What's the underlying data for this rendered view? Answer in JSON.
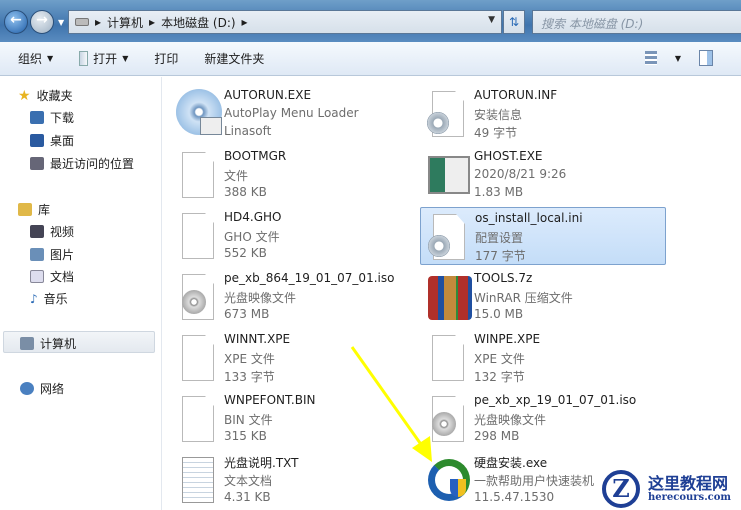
{
  "address": {
    "segments": [
      "计算机",
      "本地磁盘 (D:)"
    ],
    "search_placeholder": "搜索 本地磁盘 (D:)"
  },
  "toolbar": {
    "organize": "组织",
    "open": "打开",
    "print": "打印",
    "new_folder": "新建文件夹"
  },
  "sidebar": {
    "favorites": "收藏夹",
    "downloads": "下载",
    "desktop": "桌面",
    "recent": "最近访问的位置",
    "libraries": "库",
    "videos": "视频",
    "pictures": "图片",
    "documents": "文档",
    "music": "音乐",
    "computer": "计算机",
    "network": "网络"
  },
  "files": [
    {
      "name": "AUTORUN.EXE",
      "l2": "AutoPlay Menu Loader",
      "l3": "Linasoft",
      "icon": "autoplay-icon"
    },
    {
      "name": "AUTORUN.INF",
      "l2": "安装信息",
      "l3": "49 字节",
      "icon": "settings-file-icon"
    },
    {
      "name": "BOOTMGR",
      "l2": "文件",
      "l3": "388 KB",
      "icon": "file-icon"
    },
    {
      "name": "GHOST.EXE",
      "l2": "2020/8/21 9:26",
      "l3": "1.83 MB",
      "icon": "app-window-icon"
    },
    {
      "name": "HD4.GHO",
      "l2": "GHO 文件",
      "l3": "552 KB",
      "icon": "file-icon"
    },
    {
      "name": "os_install_local.ini",
      "l2": "配置设置",
      "l3": "177 字节",
      "icon": "settings-file-icon",
      "selected": true
    },
    {
      "name": "pe_xb_864_19_01_07_01.iso",
      "l2": "光盘映像文件",
      "l3": "673 MB",
      "icon": "disc-image-icon"
    },
    {
      "name": "TOOLS.7z",
      "l2": "WinRAR 压缩文件",
      "l3": "15.0 MB",
      "icon": "winrar-icon"
    },
    {
      "name": "WINNT.XPE",
      "l2": "XPE 文件",
      "l3": "133 字节",
      "icon": "file-icon"
    },
    {
      "name": "WINPE.XPE",
      "l2": "XPE 文件",
      "l3": "132 字节",
      "icon": "file-icon"
    },
    {
      "name": "WNPEFONT.BIN",
      "l2": "BIN 文件",
      "l3": "315 KB",
      "icon": "file-icon"
    },
    {
      "name": "pe_xb_xp_19_01_07_01.iso",
      "l2": "光盘映像文件",
      "l3": "298 MB",
      "icon": "disc-image-icon"
    },
    {
      "name": "光盘说明.TXT",
      "l2": "文本文档",
      "l3": "4.31 KB",
      "icon": "text-file-icon"
    },
    {
      "name": "硬盘安装.exe",
      "l2": "一款帮助用户快速装机",
      "l3": "11.5.47.1530",
      "icon": "installer-icon"
    }
  ],
  "watermark": {
    "title": "这里教程网",
    "url": "herecours.com"
  },
  "colors": {
    "arrow": "#ffff00",
    "selection": "#cce0f8"
  }
}
